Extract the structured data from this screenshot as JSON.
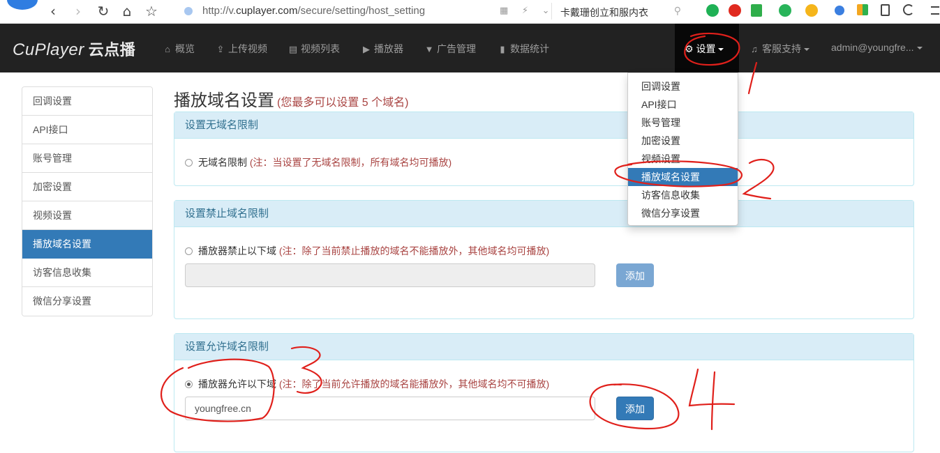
{
  "browser": {
    "url_prefix": "http://v.",
    "url_domain": "cuplayer.com",
    "url_path": "/secure/setting/host_setting",
    "search_query": "卡戴珊创立和服内衣",
    "back_icon": "‹",
    "forward_icon": "›",
    "refresh_icon": "↻",
    "home_icon": "⌂",
    "star_icon": "☆",
    "url_tools": "▦ ⚡ ⌄",
    "search_icon": "⚲"
  },
  "brand": {
    "name": "CuPlayer",
    "suffix": "云点播"
  },
  "nav": {
    "items": [
      {
        "label": "概览",
        "icon": "⌂"
      },
      {
        "label": "上传视频",
        "icon": "⇪"
      },
      {
        "label": "视频列表",
        "icon": "▤"
      },
      {
        "label": "播放器",
        "icon": "▶"
      },
      {
        "label": "广告管理",
        "icon": "▼"
      },
      {
        "label": "数据统计",
        "icon": "▮"
      }
    ],
    "settings": {
      "label": "设置",
      "icon": "⚙"
    },
    "support": {
      "label": "客服支持",
      "icon": "♫"
    },
    "user": {
      "label": "admin@youngfre..."
    }
  },
  "sidebar": {
    "items": [
      {
        "label": "回调设置"
      },
      {
        "label": "API接口"
      },
      {
        "label": "账号管理"
      },
      {
        "label": "加密设置"
      },
      {
        "label": "视频设置"
      },
      {
        "label": "播放域名设置"
      },
      {
        "label": "访客信息收集"
      },
      {
        "label": "微信分享设置"
      }
    ],
    "active_index": 5
  },
  "page": {
    "title": "播放域名设置",
    "subtitle": "(您最多可以设置 5 个域名)"
  },
  "panels": {
    "none": {
      "heading": "设置无域名限制",
      "option": "无域名限制",
      "note": "(注：当设置了无域名限制，所有域名均可播放)"
    },
    "deny": {
      "heading": "设置禁止域名限制",
      "option": "播放器禁止以下域",
      "note": "(注：除了当前禁止播放的域名不能播放外，其他域名均可播放)",
      "input_value": "",
      "button": "添加"
    },
    "allow": {
      "heading": "设置允许域名限制",
      "option": "播放器允许以下域",
      "note": "(注：除了当前允许播放的域名能播放外，其他域名均不可播放)",
      "input_value": "youngfree.cn",
      "button": "添加"
    }
  },
  "dropdown": {
    "items": [
      {
        "label": "回调设置"
      },
      {
        "label": "API接口"
      },
      {
        "label": "账号管理"
      },
      {
        "label": "加密设置"
      },
      {
        "label": "视频设置"
      },
      {
        "label": "播放域名设置"
      },
      {
        "label": "访客信息收集"
      },
      {
        "label": "微信分享设置"
      }
    ],
    "active_index": 5
  },
  "annotations": {
    "color": "#e0201b",
    "labels": [
      "1",
      "2",
      "3",
      "4"
    ]
  },
  "colors": {
    "primary": "#337ab7",
    "navbar": "#222222",
    "panel_heading": "#d9edf7",
    "note": "#a94442"
  }
}
